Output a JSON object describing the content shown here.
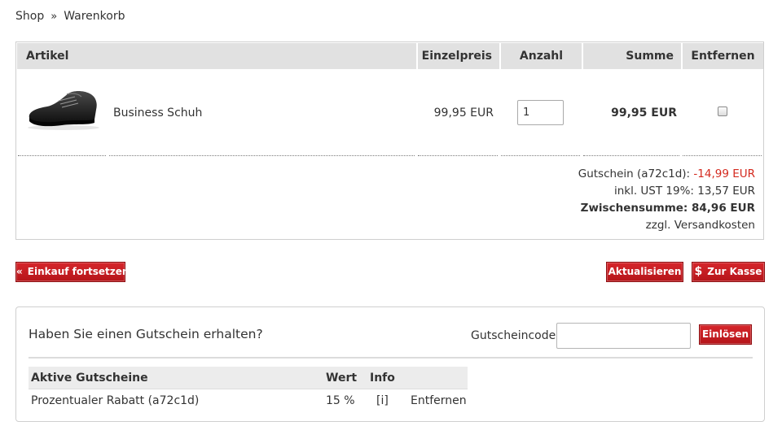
{
  "breadcrumb": {
    "items": [
      "Shop",
      "Warenkorb"
    ],
    "separator": "»"
  },
  "cart": {
    "columns": {
      "article": "Artikel",
      "unit_price": "Einzelpreis",
      "quantity": "Anzahl",
      "sum": "Summe",
      "remove": "Entfernen"
    },
    "items": [
      {
        "image": "black-dress-shoe",
        "name": "Business Schuh",
        "unit_price": "99,95 EUR",
        "quantity": "1",
        "sum": "99,95 EUR",
        "remove_checked": false
      }
    ],
    "totals": {
      "voucher_label": "Gutschein (a72c1d):",
      "voucher_value": "-14,99 EUR",
      "tax_line": "inkl. UST 19%: 13,57 EUR",
      "subtotal_line": "Zwischensumme: 84,96 EUR",
      "shipping_note": "zzgl. Versandkosten"
    }
  },
  "actions": {
    "continue_icon": "«",
    "continue_label": "Einkauf fortsetzen",
    "update_label": "Aktualisieren",
    "checkout_icon": "$",
    "checkout_label": "Zur Kasse"
  },
  "voucher": {
    "title": "Haben Sie einen Gutschein erhalten?",
    "code_label": "Gutscheincode:",
    "code_value": "",
    "redeem_label": "Einlösen",
    "active": {
      "headers": {
        "name": "Aktive Gutscheine",
        "value": "Wert",
        "info": "Info"
      },
      "rows": [
        {
          "name": "Prozentualer Rabatt (a72c1d)",
          "value": "15 %",
          "info": "[i]",
          "remove": "Entfernen"
        }
      ]
    }
  },
  "colors": {
    "accent_red": "#c41a1f",
    "negative_text": "#d42a1f",
    "header_gray": "#e1e1e1"
  }
}
